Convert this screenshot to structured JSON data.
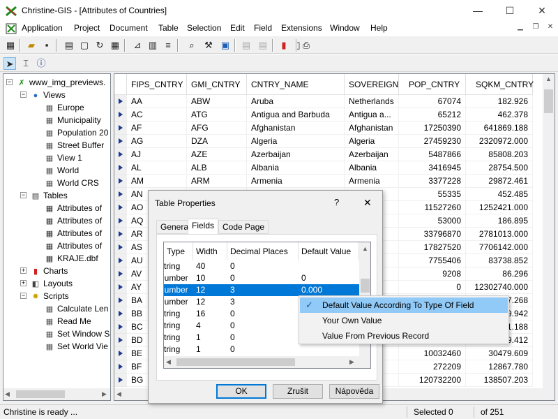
{
  "window": {
    "title": "Christine-GIS - [Attributes of Countries]"
  },
  "menu": [
    "Application",
    "Project",
    "Document",
    "Table",
    "Selection",
    "Edit",
    "Field",
    "Extensions",
    "Window",
    "Help"
  ],
  "tree": [
    {
      "label": "www_img_previews.",
      "icon": "gis-logo-icon",
      "glyph": "✗",
      "color": "#1a8c1a",
      "level": 0,
      "exp": "-"
    },
    {
      "label": "Views",
      "icon": "globe-icon",
      "glyph": "●",
      "color": "#2a6cc8",
      "level": 1,
      "exp": "-"
    },
    {
      "label": "Europe",
      "icon": "map-view-icon",
      "glyph": "▦",
      "color": "#555",
      "level": 2
    },
    {
      "label": "Municipality",
      "icon": "map-view-icon",
      "glyph": "▦",
      "color": "#555",
      "level": 2
    },
    {
      "label": "Population 20",
      "icon": "map-view-icon",
      "glyph": "▦",
      "color": "#555",
      "level": 2
    },
    {
      "label": "Street Buffer",
      "icon": "map-view-icon",
      "glyph": "▦",
      "color": "#555",
      "level": 2
    },
    {
      "label": "View 1",
      "icon": "map-view-icon",
      "glyph": "▦",
      "color": "#555",
      "level": 2
    },
    {
      "label": "World",
      "icon": "map-view-icon",
      "glyph": "▦",
      "color": "#555",
      "level": 2
    },
    {
      "label": "World CRS",
      "icon": "map-view-icon",
      "glyph": "▦",
      "color": "#555",
      "level": 2
    },
    {
      "label": "Tables",
      "icon": "tables-icon",
      "glyph": "▤",
      "color": "#333",
      "level": 1,
      "exp": "-"
    },
    {
      "label": "Attributes of",
      "icon": "table-icon",
      "glyph": "▦",
      "color": "#333",
      "level": 2
    },
    {
      "label": "Attributes of",
      "icon": "table-icon",
      "glyph": "▦",
      "color": "#333",
      "level": 2
    },
    {
      "label": "Attributes of",
      "icon": "table-icon",
      "glyph": "▦",
      "color": "#333",
      "level": 2
    },
    {
      "label": "Attributes of",
      "icon": "table-icon",
      "glyph": "▦",
      "color": "#333",
      "level": 2
    },
    {
      "label": "KRAJE.dbf",
      "icon": "table-icon",
      "glyph": "▦",
      "color": "#333",
      "level": 2
    },
    {
      "label": "Charts",
      "icon": "charts-icon",
      "glyph": "▮",
      "color": "#d02020",
      "level": 1,
      "exp": "+"
    },
    {
      "label": "Layouts",
      "icon": "layouts-icon",
      "glyph": "◧",
      "color": "#444",
      "level": 1,
      "exp": "+"
    },
    {
      "label": "Scripts",
      "icon": "scripts-icon",
      "glyph": "✹",
      "color": "#c9a400",
      "level": 1,
      "exp": "-"
    },
    {
      "label": "Calculate Len",
      "icon": "script-icon",
      "glyph": "▦",
      "color": "#555",
      "level": 2
    },
    {
      "label": "Read Me",
      "icon": "script-icon",
      "glyph": "▦",
      "color": "#555",
      "level": 2
    },
    {
      "label": "Set Window S",
      "icon": "script-icon",
      "glyph": "▦",
      "color": "#555",
      "level": 2
    },
    {
      "label": "Set World Vie",
      "icon": "script-icon",
      "glyph": "▦",
      "color": "#555",
      "level": 2
    }
  ],
  "grid": {
    "columns": [
      "FIPS_CNTRY",
      "GMI_CNTRY",
      "CNTRY_NAME",
      "SOVEREIGN",
      "POP_CNTRY",
      "SQKM_CNTRY"
    ],
    "rows": [
      [
        "AA",
        "ABW",
        "Aruba",
        "Netherlands",
        "67074",
        "182.926"
      ],
      [
        "AC",
        "ATG",
        "Antigua and Barbuda",
        "Antigua a...",
        "65212",
        "462.378"
      ],
      [
        "AF",
        "AFG",
        "Afghanistan",
        "Afghanistan",
        "17250390",
        "641869.188"
      ],
      [
        "AG",
        "DZA",
        "Algeria",
        "Algeria",
        "27459230",
        "2320972.000"
      ],
      [
        "AJ",
        "AZE",
        "Azerbaijan",
        "Azerbaijan",
        "5487866",
        "85808.203"
      ],
      [
        "AL",
        "ALB",
        "Albania",
        "Albania",
        "3416945",
        "28754.500"
      ],
      [
        "AM",
        "ARM",
        "Armenia",
        "Armenia",
        "3377228",
        "29872.461"
      ],
      [
        "AN",
        "AND",
        "Andorra",
        "Andorra",
        "55335",
        "452.485"
      ],
      [
        "AO",
        "",
        "",
        "",
        "11527260",
        "1252421.000"
      ],
      [
        "AQ",
        "",
        "",
        "tes",
        "53000",
        "186.895"
      ],
      [
        "AR",
        "",
        "",
        "",
        "33796870",
        "2781013.000"
      ],
      [
        "AS",
        "",
        "",
        "",
        "17827520",
        "7706142.000"
      ],
      [
        "AU",
        "",
        "",
        "",
        "7755406",
        "83738.852"
      ],
      [
        "AV",
        "",
        "",
        "",
        "9208",
        "86.296"
      ],
      [
        "AY",
        "",
        "",
        "a",
        "0",
        "12302740.000"
      ],
      [
        "BA",
        "",
        "",
        "",
        "",
        "7.268"
      ],
      [
        "BB",
        "",
        "",
        "",
        "",
        "9.942"
      ],
      [
        "BC",
        "",
        "",
        "",
        "",
        "1.188"
      ],
      [
        "BD",
        "",
        "",
        "",
        "",
        "9.412"
      ],
      [
        "BE",
        "",
        "",
        "",
        "10032460",
        "30479.609"
      ],
      [
        "BF",
        "",
        "",
        "...",
        "272209",
        "12867.780"
      ],
      [
        "BG",
        "",
        "",
        "sh",
        "120732200",
        "138507.203"
      ]
    ]
  },
  "status": {
    "message": "Christine is ready ...",
    "selected": "Selected 0",
    "total": "of 251"
  },
  "dialog": {
    "title": "Table Properties",
    "help": "?",
    "close": "✕",
    "tabs": [
      "General",
      "Fields",
      "Code Page"
    ],
    "field_columns": [
      "Type",
      "Width",
      "Decimal Places",
      "Default Value"
    ],
    "field_rows": [
      [
        "String",
        "40",
        "0",
        ""
      ],
      [
        "Number",
        "10",
        "0",
        "0"
      ],
      [
        "Number",
        "12",
        "3",
        "0.000"
      ],
      [
        "Number",
        "12",
        "3",
        ""
      ],
      [
        "String",
        "16",
        "0",
        ""
      ],
      [
        "String",
        "4",
        "0",
        ""
      ],
      [
        "String",
        "1",
        "0",
        ""
      ],
      [
        "String",
        "1",
        "0",
        ""
      ]
    ],
    "selected_row": 2,
    "ok": "OK",
    "cancel": "Zrušit",
    "help_button": "Nápověda"
  },
  "context_menu": {
    "items": [
      "Default Value According To Type Of Field",
      "Your Own Value",
      "Value From Previous Record"
    ],
    "checked": 0
  }
}
